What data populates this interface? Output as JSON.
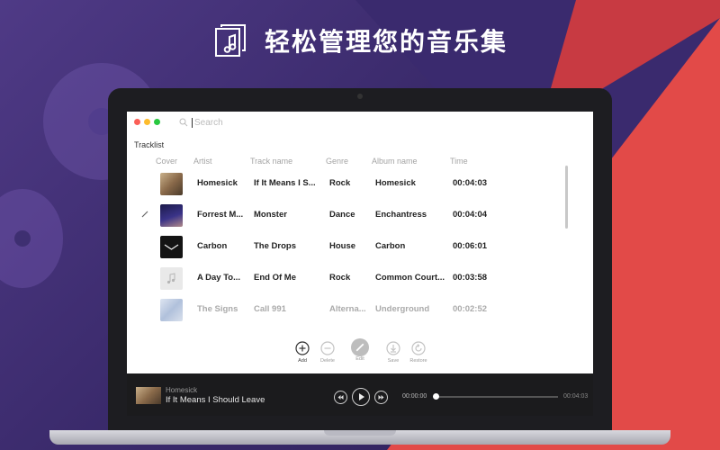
{
  "headline": {
    "icon": "music-library-icon",
    "title": "轻松管理您的音乐集"
  },
  "window": {
    "search": {
      "placeholder": "Search",
      "value": ""
    },
    "tracklist_label": "Tracklist",
    "columns": [
      "Cover",
      "Artist",
      "Track name",
      "Genre",
      "Album name",
      "Time"
    ],
    "rows": [
      {
        "artist": "Homesick",
        "track": "If It Means I S...",
        "genre": "Rock",
        "album": "Homesick",
        "time": "00:04:03",
        "cover_color": "#8a6a4a",
        "state": "normal"
      },
      {
        "artist": "Forrest M...",
        "track": "Monster",
        "genre": "Dance",
        "album": "Enchantress",
        "time": "00:04:04",
        "cover_color": "#2d2a6a",
        "state": "editing"
      },
      {
        "artist": "Carbon",
        "track": "The Drops",
        "genre": "House",
        "album": "Carbon",
        "time": "00:06:01",
        "cover_color": "#141414",
        "state": "normal"
      },
      {
        "artist": "A Day To...",
        "track": "End Of Me",
        "genre": "Rock",
        "album": "Common Court...",
        "time": "00:03:58",
        "cover_color": "#e6e6e6",
        "state": "normal"
      },
      {
        "artist": "The Signs",
        "track": "Call 991",
        "genre": "Alterna...",
        "album": "Underground",
        "time": "00:02:52",
        "cover_color": "#9fb4d6",
        "state": "faded"
      }
    ],
    "toolbar": [
      {
        "name": "add",
        "label": "Add",
        "icon": "plus-circle-icon",
        "active": true
      },
      {
        "name": "delete",
        "label": "Delete",
        "icon": "minus-circle-icon",
        "active": false
      },
      {
        "name": "edit",
        "label": "Edit",
        "icon": "pencil-circle-icon",
        "active": false
      },
      {
        "name": "save",
        "label": "Save",
        "icon": "download-icon",
        "active": false
      },
      {
        "name": "restore",
        "label": "Restore",
        "icon": "restore-icon",
        "active": false
      }
    ],
    "player": {
      "artist": "Homesick",
      "track": "If It Means I Should Leave",
      "time_elapsed": "00:00:00",
      "time_total": "00:04:03",
      "progress_fraction": 0
    }
  },
  "colors": {
    "accent_red": "#e24a48",
    "purple": "#3a2a6b",
    "player_bg": "#1b1b1d"
  }
}
